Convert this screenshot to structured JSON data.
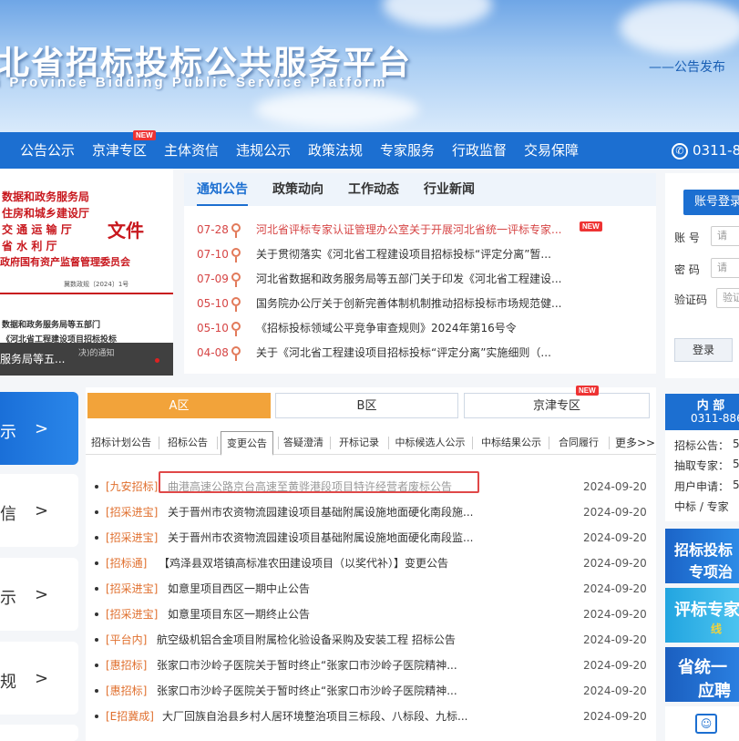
{
  "header": {
    "title": "北省招标投标公共服务平台",
    "subtitle": "i  Province  Bidding  Public  Service  Platform",
    "slogan": "——公告发布"
  },
  "nav": {
    "items": [
      "公告公示",
      "京津专区",
      "主体资信",
      "违规公示",
      "政策法规",
      "专家服务",
      "行政监督",
      "交易保障"
    ],
    "new_badge": "NEW",
    "phone": "0311-88"
  },
  "doc_image": {
    "lines": [
      "数据和政务服务局",
      "住房和城乡建设厅",
      "交 通 运 输 厅",
      "省   水   利   厅",
      "政府国有资产监督管理委员会"
    ],
    "file_word": "文件",
    "doc_number": "冀数政规〔2024〕1号",
    "body1": "数据和政务服务局等五部门",
    "body2": "《河北省工程建设项目招标投标",
    "caption": "服务局等五...",
    "caption_tail": "决)的通知"
  },
  "news": {
    "tabs": [
      "通知公告",
      "政策动向",
      "工作动态",
      "行业新闻"
    ],
    "items": [
      {
        "date": "07-28",
        "title": "河北省评标专家认证管理办公室关于开展河北省统一评标专家...",
        "new": "NEW"
      },
      {
        "date": "07-10",
        "title": "关于贯彻落实《河北省工程建设项目招标投标“评定分离”暂..."
      },
      {
        "date": "07-09",
        "title": "河北省数据和政务服务局等五部门关于印发《河北省工程建设..."
      },
      {
        "date": "05-10",
        "title": "国务院办公厅关于创新完善体制机制推动招标投标市场规范健..."
      },
      {
        "date": "05-10",
        "title": "《招标投标领域公平竞争审查规则》2024年第16号令"
      },
      {
        "date": "04-08",
        "title": "关于《河北省工程建设项目招标投标“评定分离”实施细则（..."
      }
    ]
  },
  "login": {
    "button": "账号登录",
    "account_label": "账  号",
    "password_label": "密  码",
    "captcha_label": "验证码",
    "account_placeholder": "请",
    "password_placeholder": "请",
    "captcha_placeholder": "验证",
    "submit": "登录"
  },
  "side_tiles": [
    {
      "label": "示",
      "arrow": ">"
    },
    {
      "label": "信",
      "arrow": ">"
    },
    {
      "label": "示",
      "arrow": ">"
    },
    {
      "label": "规",
      "arrow": ">"
    }
  ],
  "zones": {
    "tabs": [
      "A区",
      "B区",
      "京津专区"
    ],
    "new_badge": "NEW",
    "sub_tabs": [
      "招标计划公告",
      "招标公告",
      "变更公告",
      "答疑澄清",
      "开标记录",
      "中标候选人公示",
      "中标结果公示",
      "合同履行",
      "更多>>"
    ],
    "active_sub": "变更公告"
  },
  "announcements": [
    {
      "tag": "[九安招标]",
      "title": "曲港高速公路京台高速至黄骅港段项目特许经营者废标公告",
      "date": "2024-09-20"
    },
    {
      "tag": "[招采进宝]",
      "title": "关于晋州市农资物流园建设项目基础附属设施地面硬化南段施...",
      "date": "2024-09-20"
    },
    {
      "tag": "[招采进宝]",
      "title": "关于晋州市农资物流园建设项目基础附属设施地面硬化南段监...",
      "date": "2024-09-20"
    },
    {
      "tag": "[招标通]",
      "title": "【鸡泽县双塔镇高标准农田建设项目（以奖代补）】变更公告",
      "date": "2024-09-20"
    },
    {
      "tag": "[招采进宝]",
      "title": "如意里项目西区一期中止公告",
      "date": "2024-09-20"
    },
    {
      "tag": "[招采进宝]",
      "title": "如意里项目东区一期终止公告",
      "date": "2024-09-20"
    },
    {
      "tag": "[平台内]",
      "title": "航空级机铝合金项目附属检化验设备采购及安装工程 招标公告",
      "date": "2024-09-20"
    },
    {
      "tag": "[惠招标]",
      "title": "张家口市沙岭子医院关于暂时终止“张家口市沙岭子医院精神...",
      "date": "2024-09-20"
    },
    {
      "tag": "[惠招标]",
      "title": "张家口市沙岭子医院关于暂时终止“张家口市沙岭子医院精神...",
      "date": "2024-09-20"
    },
    {
      "tag": "[E招冀成]",
      "title": "大厂回族自治县乡村人居环境整治项目三标段、八标段、九标...",
      "date": "2024-09-20"
    }
  ],
  "right_col": {
    "hotline_title": "内 部",
    "hotline_number": "0311-886",
    "stats": [
      "招标公告：",
      "抽取专家：",
      "用户申请：",
      "中标 / 专家"
    ],
    "stats_tail": [
      "5",
      "5",
      "5",
      ""
    ],
    "banners": [
      {
        "l1": "招标投标",
        "l2": "专项治"
      },
      {
        "l1": "评标专家",
        "l2": "线"
      },
      {
        "l1": "省统一",
        "l2": "应聘"
      }
    ]
  },
  "colors": {
    "primary": "#1c6fd1",
    "accent_orange": "#f2a33a",
    "news_red": "#d64545",
    "tag_orange": "#e0702f"
  }
}
